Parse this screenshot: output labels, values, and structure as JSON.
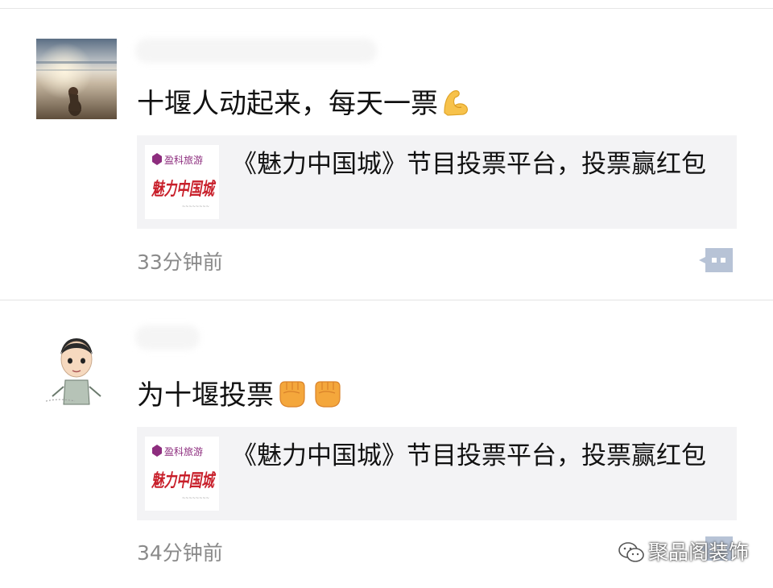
{
  "colors": {
    "background": "#ffffff",
    "card_background": "#f3f3f5",
    "timestamp_text": "#8a8a8a",
    "comment_button": "#b7c3d6"
  },
  "posts": [
    {
      "avatar_icon": "beach-sunset-photo-avatar",
      "text": "十堰人动起来，每天一票",
      "emoji_icon": "flexed-biceps-emoji",
      "link_card": {
        "thumb_brand": "盈科旅游",
        "thumb_logo": "魅力中国城",
        "title": "《魅力中国城》节目投票平台，投票赢红包"
      },
      "timestamp": "33分钟前",
      "comment_icon": "comment-dots-icon"
    },
    {
      "avatar_icon": "cartoon-man-avatar",
      "text": "为十堰投票",
      "emoji_icon": "raised-fist-emoji",
      "link_card": {
        "thumb_brand": "盈科旅游",
        "thumb_logo": "魅力中国城",
        "title": "《魅力中国城》节目投票平台，投票赢红包"
      },
      "timestamp": "34分钟前",
      "comment_icon": "comment-dots-icon"
    }
  ],
  "watermark": {
    "icon": "wechat-icon",
    "text": "聚品阁装饰"
  }
}
